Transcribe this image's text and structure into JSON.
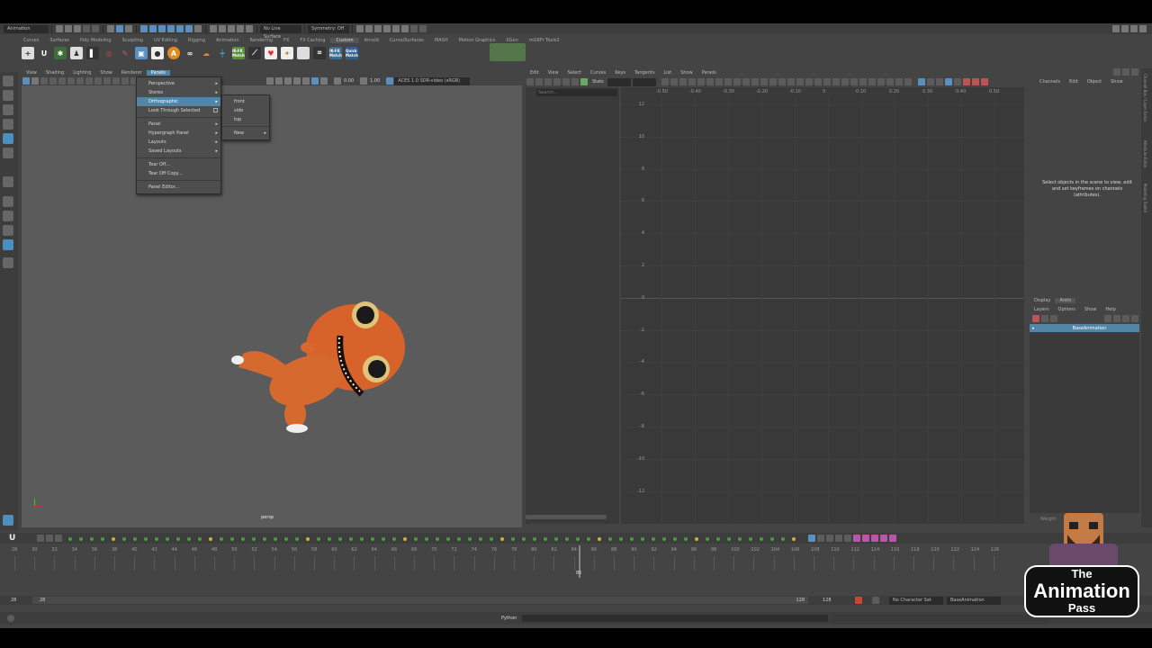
{
  "status_line": {
    "mode_dropdown": "Animation",
    "live_surface": "No Live Surface",
    "symmetry": "Symmetry: Off"
  },
  "shelf": {
    "tabs": [
      "Curves",
      "Surfaces",
      "Poly Modeling",
      "Sculpting",
      "UV Editing",
      "Rigging",
      "Animation",
      "Rendering",
      "FX",
      "FX Caching",
      "Custom",
      "Arnold",
      "Curve/Surfaces",
      "MASH",
      "Motion Graphics",
      "XGen",
      "mGRFr Tools2"
    ],
    "active_tab": "Custom",
    "icons": [
      {
        "name": "ik-fk-match-icon",
        "label": "IK-FK Match"
      },
      {
        "name": "ik-fk-switch-icon",
        "label": "IK-FK Match"
      },
      {
        "name": "quick-match-icon",
        "label": "Quick Match"
      }
    ]
  },
  "viewport": {
    "menu": [
      "View",
      "Shading",
      "Lighting",
      "Show",
      "Renderer",
      "Panels"
    ],
    "active_menu": "Panels",
    "camera_label": "persp",
    "exposure": "0.00",
    "gamma": "1.00",
    "color_space": "ACES 1.0 SDR-video (sRGB)"
  },
  "panels_menu": {
    "items": [
      {
        "label": "Perspective",
        "submenu": true
      },
      {
        "label": "Stereo",
        "submenu": true
      },
      {
        "label": "Orthographic",
        "submenu": true,
        "highlight": true
      },
      {
        "label": "Look Through Selected",
        "option_box": true
      },
      {
        "separator": true
      },
      {
        "label": "Panel",
        "submenu": true
      },
      {
        "label": "Hypergraph Panel",
        "submenu": true
      },
      {
        "label": "Layouts",
        "submenu": true
      },
      {
        "label": "Saved Layouts",
        "submenu": true
      },
      {
        "separator": true
      },
      {
        "label": "Tear Off..."
      },
      {
        "label": "Tear Off Copy..."
      },
      {
        "separator": true
      },
      {
        "label": "Panel Editor..."
      }
    ]
  },
  "ortho_submenu": {
    "items": [
      {
        "label": "front"
      },
      {
        "label": "side"
      },
      {
        "label": "top"
      },
      {
        "separator": true
      },
      {
        "label": "New",
        "submenu": true
      }
    ]
  },
  "graph_editor": {
    "menu": [
      "Edit",
      "View",
      "Select",
      "Curves",
      "Keys",
      "Tangents",
      "List",
      "Show",
      "Panels"
    ],
    "stats_label": "Stats",
    "search_placeholder": "Search...",
    "y_labels": [
      "12",
      "10",
      "8",
      "6",
      "4",
      "2",
      "0",
      "-2",
      "-4",
      "-6",
      "-8",
      "-10",
      "-12"
    ],
    "x_labels": [
      "-0.50",
      "-0.40",
      "-0.30",
      "-0.20",
      "-0.10",
      "0",
      "0.10",
      "0.20",
      "0.30",
      "0.40",
      "0.50"
    ]
  },
  "channel_box": {
    "menu": [
      "Channels",
      "Edit",
      "Object",
      "Show"
    ],
    "hint": "Select objects in the scene to view, edit and set keyframes on channels (attributes).",
    "side_tabs": [
      "Channel Box / Layer Editor",
      "Attribute Editor",
      "Modeling Toolkit"
    ]
  },
  "layer_editor": {
    "tabs": [
      "Display",
      "Anim"
    ],
    "active_tab": "Anim",
    "menu": [
      "Layers",
      "Options",
      "Show",
      "Help"
    ],
    "layer_name": "BaseAnimation",
    "weight_label": "Weight"
  },
  "time_slider": {
    "ticks": [
      "28",
      "30",
      "32",
      "34",
      "36",
      "38",
      "40",
      "42",
      "44",
      "46",
      "48",
      "50",
      "52",
      "54",
      "56",
      "58",
      "60",
      "62",
      "64",
      "66",
      "68",
      "70",
      "72",
      "74",
      "76",
      "78",
      "80",
      "82",
      "84",
      "86",
      "88",
      "90",
      "92",
      "94",
      "96",
      "98",
      "100",
      "102",
      "104",
      "106",
      "108",
      "110",
      "112",
      "114",
      "116",
      "118",
      "120",
      "122",
      "124",
      "126"
    ],
    "current_frame": "85"
  },
  "range_slider": {
    "start": "28",
    "range_start": "28",
    "range_end": "128",
    "end": "128",
    "character_set": "No Character Set",
    "anim_layer": "BaseAnimation"
  },
  "command_line": {
    "language": "Python"
  },
  "watermark": {
    "line1": "The",
    "line2": "Animation",
    "line3": "Pass"
  },
  "colors": {
    "highlight": "#5285a6",
    "ui_bg": "#444444",
    "layer_selected": "#5285a6"
  }
}
